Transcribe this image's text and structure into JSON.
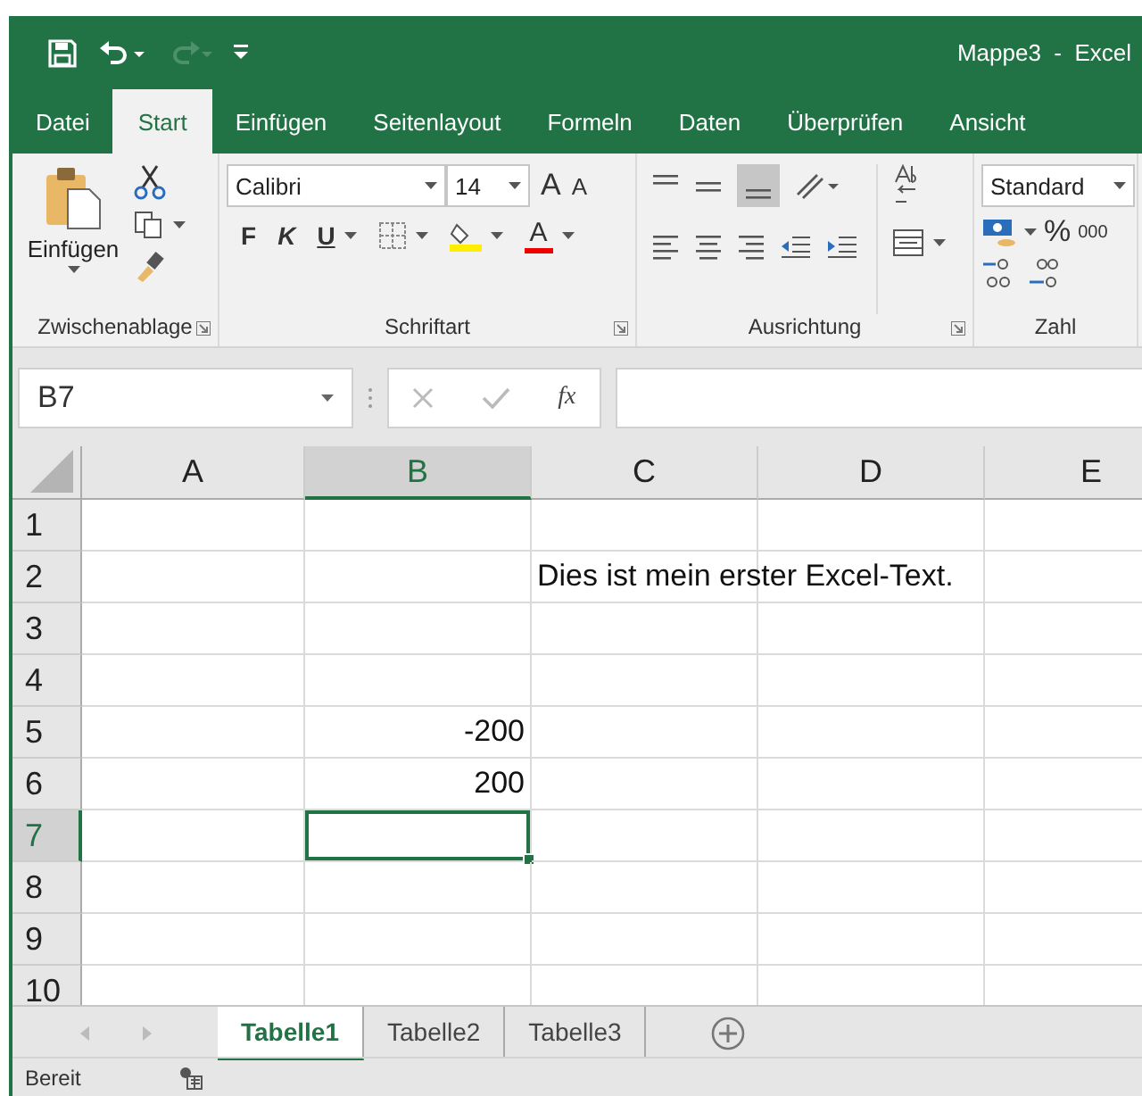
{
  "quick_access": {
    "undo_enabled": true,
    "redo_enabled": false
  },
  "window": {
    "title": "Mappe3  -  Excel"
  },
  "tabs": [
    {
      "label": "Datei",
      "selected": false
    },
    {
      "label": "Start",
      "selected": true
    },
    {
      "label": "Einfügen",
      "selected": false
    },
    {
      "label": "Seitenlayout",
      "selected": false
    },
    {
      "label": "Formeln",
      "selected": false
    },
    {
      "label": "Daten",
      "selected": false
    },
    {
      "label": "Überprüfen",
      "selected": false
    },
    {
      "label": "Ansicht",
      "selected": false
    }
  ],
  "ribbon": {
    "clipboard": {
      "paste": "Einfügen",
      "label": "Zwischenablage"
    },
    "font": {
      "name": "Calibri",
      "size": "14",
      "grow": "A",
      "shrink": "A",
      "bold": "F",
      "italic": "K",
      "underline": "U",
      "font_color": "A",
      "label": "Schriftart"
    },
    "alignment": {
      "label": "Ausrichtung"
    },
    "number": {
      "format": "Standard",
      "percent": "%",
      "thousands": "000",
      "label": "Zahl"
    }
  },
  "formula_bar": {
    "name_box": "B7",
    "fx": "fx"
  },
  "sheet": {
    "columns": [
      {
        "label": "A",
        "selected": false
      },
      {
        "label": "B",
        "selected": true
      },
      {
        "label": "C",
        "selected": false
      },
      {
        "label": "D",
        "selected": false
      },
      {
        "label": "E",
        "selected": false
      }
    ],
    "rows": [
      {
        "label": "1",
        "selected": false,
        "cells": [
          null,
          null,
          null,
          null,
          null
        ]
      },
      {
        "label": "2",
        "selected": false,
        "cells": [
          null,
          null,
          {
            "kind": "text",
            "text": "Dies ist mein erster Excel-Text."
          },
          null,
          null
        ]
      },
      {
        "label": "3",
        "selected": false,
        "cells": [
          null,
          null,
          null,
          null,
          null
        ]
      },
      {
        "label": "4",
        "selected": false,
        "cells": [
          null,
          null,
          null,
          null,
          null
        ]
      },
      {
        "label": "5",
        "selected": false,
        "cells": [
          null,
          {
            "kind": "number",
            "text": "-200"
          },
          null,
          null,
          null
        ]
      },
      {
        "label": "6",
        "selected": false,
        "cells": [
          null,
          {
            "kind": "number",
            "text": "200"
          },
          null,
          null,
          null
        ]
      },
      {
        "label": "7",
        "selected": true,
        "cells": [
          null,
          null,
          null,
          null,
          null
        ]
      },
      {
        "label": "8",
        "selected": false,
        "cells": [
          null,
          null,
          null,
          null,
          null
        ]
      },
      {
        "label": "9",
        "selected": false,
        "cells": [
          null,
          null,
          null,
          null,
          null
        ]
      },
      {
        "label": "10",
        "selected": false,
        "cells": [
          null,
          null,
          null,
          null,
          null
        ]
      }
    ]
  },
  "sheet_tabs": [
    {
      "label": "Tabelle1",
      "selected": true
    },
    {
      "label": "Tabelle2",
      "selected": false
    },
    {
      "label": "Tabelle3",
      "selected": false
    }
  ],
  "status_bar": {
    "text": "Bereit"
  }
}
